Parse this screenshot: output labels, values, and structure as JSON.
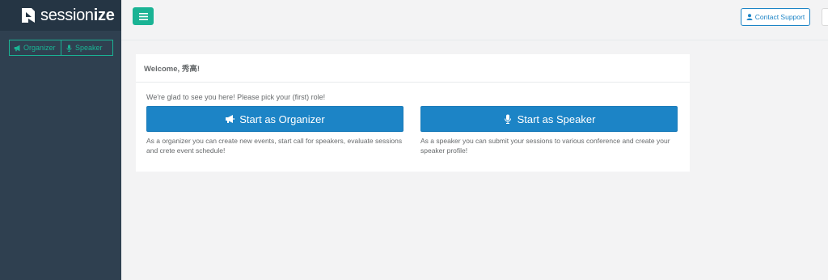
{
  "brand": {
    "name_light": "sess",
    "name_mid": "ion",
    "name_bold": "ize",
    "icon": "sessionize-logo-icon"
  },
  "sidebar": {
    "roles": [
      {
        "label": "Organizer",
        "icon": "megaphone-icon"
      },
      {
        "label": "Speaker",
        "icon": "microphone-icon"
      }
    ]
  },
  "topbar": {
    "menu_icon": "hamburger-icon",
    "support_label": "Contact Support",
    "support_icon": "user-icon"
  },
  "panel": {
    "title": "Welcome, 秀高!",
    "intro": "We're glad to see you here! Please pick your (first) role!",
    "organizer_button": "Start as Organizer",
    "speaker_button": "Start as Speaker",
    "organizer_desc": "As a organizer you can create new events, start call for speakers, evaluate sessions and crete event schedule!",
    "speaker_desc": "As a speaker you can submit your sessions to various conference and create your speaker profile!"
  },
  "colors": {
    "sidebar": "#2f4050",
    "brand_bg": "#253544",
    "accent_green": "#1ab394",
    "primary_blue": "#1c84c6",
    "page_bg": "#f3f3f4"
  }
}
